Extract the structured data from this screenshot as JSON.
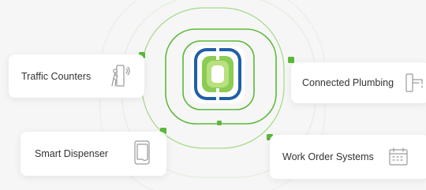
{
  "cards": [
    {
      "label": "Traffic Counters",
      "icon": "pedestrian-counter-icon"
    },
    {
      "label": "Connected Plumbing",
      "icon": "faucet-icon"
    },
    {
      "label": "Smart Dispenser",
      "icon": "paper-towel-dispenser-icon"
    },
    {
      "label": "Work Order Systems",
      "icon": "calendar-icon"
    }
  ],
  "colors": {
    "background": "#f6f6f6",
    "accent_green": "#5cb83a",
    "ring_green": "#8fce6a",
    "logo_blue": "#1f5fa6",
    "logo_green": "#8ccc55",
    "text": "#333333",
    "icon_gray": "#9a9a9a"
  }
}
